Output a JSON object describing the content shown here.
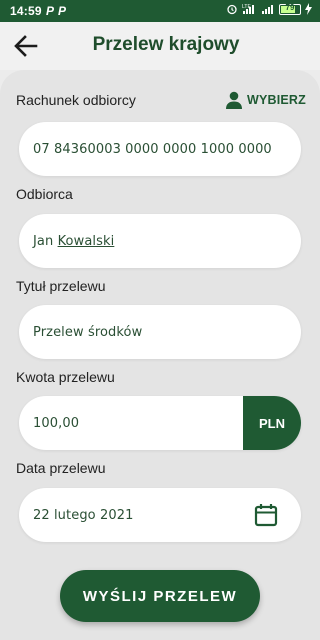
{
  "status_bar": {
    "time": "14:59",
    "notification_icons": [
      "P",
      "P"
    ],
    "battery_level": "79",
    "icons": [
      "alarm-icon",
      "lte-signal-icon",
      "signal-icon",
      "battery-icon",
      "charging-icon"
    ]
  },
  "header": {
    "title": "Przelew krajowy",
    "back_icon": "arrow-left-icon"
  },
  "form": {
    "account": {
      "label": "Rachunek odbiorcy",
      "choose_label": "WYBIERZ",
      "value": "07 84360003 0000 0000 1000 0000"
    },
    "recipient": {
      "label": "Odbiorca",
      "first_name": "Jan",
      "last_name": "Kowalski"
    },
    "title": {
      "label": "Tytuł przelewu",
      "value": "Przelew środków"
    },
    "amount": {
      "label": "Kwota przelewu",
      "value": "100,00",
      "currency": "PLN"
    },
    "date": {
      "label": "Data przelewu",
      "value": "22 lutego 2021",
      "icon": "calendar-icon"
    }
  },
  "send_button": "WYŚLIJ PRZELEW",
  "colors": {
    "brand_green": "#1f5a33",
    "title_green": "#1f4d2c",
    "background": "#e4e4e4"
  }
}
